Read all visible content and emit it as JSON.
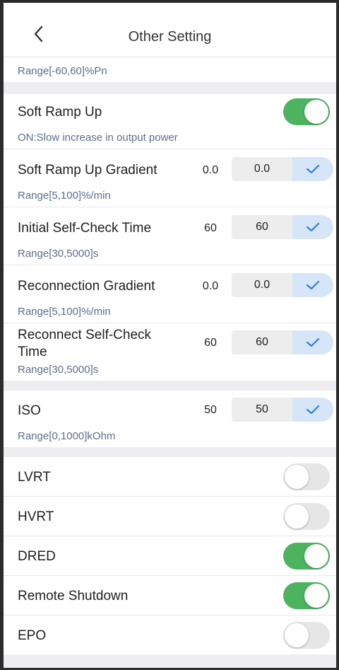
{
  "header": {
    "title": "Other Setting"
  },
  "top_range": "Range[-60,60]%Pn",
  "soft_ramp_up": {
    "label": "Soft Ramp Up",
    "enabled": true,
    "note": "ON:Slow increase in output power"
  },
  "params": [
    {
      "label": "Soft Ramp Up Gradient",
      "current": "0.0",
      "input": "0.0",
      "range": "Range[5,100]%/min"
    },
    {
      "label": "Initial Self-Check Time",
      "current": "60",
      "input": "60",
      "range": "Range[30,5000]s"
    },
    {
      "label": "Reconnection Gradient",
      "current": "0.0",
      "input": "0.0",
      "range": "Range[5,100]%/min"
    },
    {
      "label_line1": "Reconnect Self-Check",
      "label_line2": "Time",
      "current": "60",
      "input": "60",
      "range": "Range[30,5000]s"
    }
  ],
  "iso": {
    "label": "ISO",
    "current": "50",
    "input": "50",
    "range": "Range[0,1000]kOhm"
  },
  "switches": [
    {
      "label": "LVRT",
      "enabled": false
    },
    {
      "label": "HVRT",
      "enabled": false
    },
    {
      "label": "DRED",
      "enabled": true
    },
    {
      "label": "Remote Shutdown",
      "enabled": true
    },
    {
      "label": "EPO",
      "enabled": false
    }
  ],
  "colors": {
    "toggle_on": "#4cb35f",
    "toggle_off": "#e6e6e6",
    "confirm": "#d6e6f8",
    "check": "#2f7fd6",
    "range_text": "#5b6f8c"
  }
}
